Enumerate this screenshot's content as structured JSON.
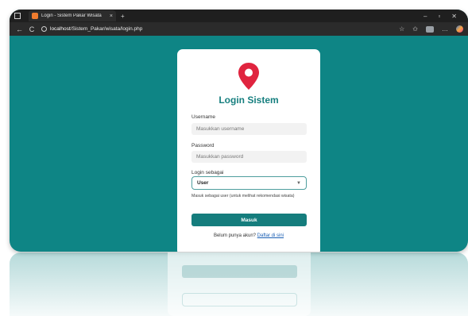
{
  "browser": {
    "tab_title": "Login - Sistem Pakar Wisata",
    "tab_close": "×",
    "new_tab": "+",
    "url_host": "localhost",
    "url_path": "/Sistem_Pakar/wisata/login.php",
    "win_minimize": "–",
    "win_maximize": "▫",
    "win_close": "✕",
    "back": "←",
    "reload": "C"
  },
  "login": {
    "title": "Login Sistem",
    "username_label": "Username",
    "username_placeholder": "Masukkan username",
    "password_label": "Password",
    "password_placeholder": "Masukkan password",
    "role_label": "Login sebagai",
    "role_value": "User",
    "role_hint": "Masuk sebagai user (untuk melihat rekomendasi wisata)",
    "submit_label": "Masuk",
    "register_prompt": "Belum punya akun?",
    "register_link": "Daftar di sini"
  },
  "colors": {
    "background": "#0e8585",
    "accent": "#157d7d",
    "pin": "#e0243f",
    "link": "#1a5fb4"
  },
  "icons": [
    "window-icon",
    "favicon-icon",
    "back-arrow-icon",
    "reload-icon",
    "info-icon",
    "favorite-icon",
    "favorites-icon",
    "extension-icon",
    "more-icon",
    "copilot-icon",
    "location-pin-icon",
    "chevron-down-icon"
  ]
}
